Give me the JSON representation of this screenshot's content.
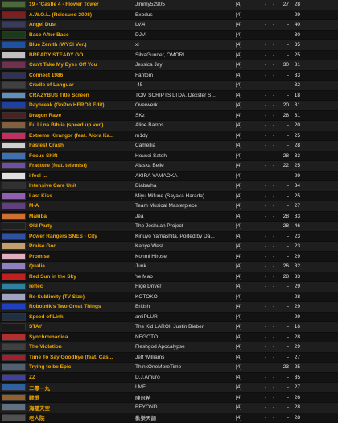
{
  "rows": [
    {
      "title": "19 - 'Castle 4 - Flower Tower",
      "artist": "Jimmy52905",
      "level": "[4]",
      "c1": "-",
      "c2": "-",
      "c3": "27",
      "c4": "28",
      "thumb": "#4a6a3a"
    },
    {
      "title": "A.W.O.L. (Reissued 2008)",
      "artist": "Exodus",
      "level": "[4]",
      "c1": "-",
      "c2": "-",
      "c3": "-",
      "c4": "29",
      "thumb": "#7a2020"
    },
    {
      "title": "Angel Dust",
      "artist": "LV.4",
      "level": "[4]",
      "c1": "-",
      "c2": "-",
      "c3": "-",
      "c4": "40",
      "thumb": "#3a3a5a"
    },
    {
      "title": "Base After Base",
      "artist": "DJVI",
      "level": "[4]",
      "c1": "-",
      "c2": "-",
      "c3": "-",
      "c4": "30",
      "thumb": "#1a3a1a"
    },
    {
      "title": "Blue Zenith (WYSI Ver.)",
      "artist": "xi",
      "level": "[4]",
      "c1": "-",
      "c2": "-",
      "c3": "-",
      "c4": "35",
      "thumb": "#2050a0"
    },
    {
      "title": "BREADY STEADY GO",
      "artist": "SilvaGunner, OMORI",
      "level": "[4]",
      "c1": "-",
      "c2": "-",
      "c3": "-",
      "c4": "25",
      "thumb": "#c0c0c0"
    },
    {
      "title": "Can't Take My Eyes Off You",
      "artist": "Jessica Jay",
      "level": "[4]",
      "c1": "-",
      "c2": "-",
      "c3": "30",
      "c4": "31",
      "thumb": "#703050"
    },
    {
      "title": "Connect 1986",
      "artist": "Fantom",
      "level": "[4]",
      "c1": "-",
      "c2": "-",
      "c3": "-",
      "c4": "33",
      "thumb": "#303060"
    },
    {
      "title": "Cradle of Languar",
      "artist": "-45",
      "level": "[4]",
      "c1": "-",
      "c2": "-",
      "c3": "-",
      "c4": "32",
      "thumb": "#404040"
    },
    {
      "title": "CRAZYBUS Title Screen",
      "artist": "TOM SCRIPTS LTDA, Dexster S...",
      "level": "[4]",
      "c1": "-",
      "c2": "-",
      "c3": "-",
      "c4": "18",
      "thumb": "#6090c0"
    },
    {
      "title": "Daybreak (GoPro HERO3 Edit)",
      "artist": "Overwerk",
      "level": "[4]",
      "c1": "-",
      "c2": "-",
      "c3": "20",
      "c4": "31",
      "thumb": "#2040a0"
    },
    {
      "title": "Dragon Rave",
      "artist": "SKz",
      "level": "[4]",
      "c1": "-",
      "c2": "-",
      "c3": "28",
      "c4": "31",
      "thumb": "#502020"
    },
    {
      "title": "Eu Li na Bíblia (speed up ver.)",
      "artist": "Aline Barros",
      "level": "[4]",
      "c1": "-",
      "c2": "-",
      "c3": "-",
      "c4": "20",
      "thumb": "#806040"
    },
    {
      "title": "Extreme Kirangor (feat. Alora Ka...",
      "artist": "m1dy",
      "level": "[4]",
      "c1": "-",
      "c2": "-",
      "c3": "-",
      "c4": "25",
      "thumb": "#c03060"
    },
    {
      "title": "Fastest Crash",
      "artist": "Camellia",
      "level": "[4]",
      "c1": "-",
      "c2": "-",
      "c3": "-",
      "c4": "28",
      "thumb": "#d0d0d0"
    },
    {
      "title": "Focus Shift",
      "artist": "Housei Satoh",
      "level": "[4]",
      "c1": "-",
      "c2": "-",
      "c3": "28",
      "c4": "33",
      "thumb": "#4070b0"
    },
    {
      "title": "Fracture (feat. telemist)",
      "artist": "Alaska Belle",
      "level": "[4]",
      "c1": "-",
      "c2": "-",
      "c3": "22",
      "c4": "25",
      "thumb": "#7050a0"
    },
    {
      "title": "i feel ...",
      "artist": "AKIRA YAMAOKA",
      "level": "[4]",
      "c1": "-",
      "c2": "-",
      "c3": "-",
      "c4": "29",
      "thumb": "#e0e0e0"
    },
    {
      "title": "Intensive Care Unit",
      "artist": "Diabarha",
      "level": "[4]",
      "c1": "-",
      "c2": "-",
      "c3": "-",
      "c4": "34",
      "thumb": "#303030"
    },
    {
      "title": "Last Kiss",
      "artist": "Miyu Mifune (Sayaka Harada)",
      "level": "[4]",
      "c1": "-",
      "c2": "-",
      "c3": "-",
      "c4": "25",
      "thumb": "#9060b0"
    },
    {
      "title": "M-A",
      "artist": "Team Musical Masterpiece",
      "level": "[4]",
      "c1": "-",
      "c2": "-",
      "c3": "-",
      "c4": "27",
      "thumb": "#604080"
    },
    {
      "title": "Makiba",
      "artist": "Jea",
      "level": "[4]",
      "c1": "-",
      "c2": "-",
      "c3": "28",
      "c4": "33",
      "thumb": "#d07030"
    },
    {
      "title": "Old Party",
      "artist": "The Joshuan Project",
      "level": "[4]",
      "c1": "-",
      "c2": "-",
      "c3": "28",
      "c4": "46",
      "thumb": "#202020"
    },
    {
      "title": "Power Rangers SNES - City",
      "artist": "Kinuyo Yamashita, Ported by Da...",
      "level": "[4]",
      "c1": "-",
      "c2": "-",
      "c3": "-",
      "c4": "23",
      "thumb": "#3050a0"
    },
    {
      "title": "Praise God",
      "artist": "Kanye West",
      "level": "[4]",
      "c1": "-",
      "c2": "-",
      "c3": "-",
      "c4": "23",
      "thumb": "#c0a070"
    },
    {
      "title": "Promise",
      "artist": "Kohmi Hirose",
      "level": "[4]",
      "c1": "-",
      "c2": "-",
      "c3": "-",
      "c4": "29",
      "thumb": "#e0b0c0"
    },
    {
      "title": "Qualia",
      "artist": "Junk",
      "level": "[4]",
      "c1": "-",
      "c2": "-",
      "c3": "26",
      "c4": "32",
      "thumb": "#9080c0"
    },
    {
      "title": "Red Sun in the Sky",
      "artist": "Ye Mao",
      "level": "[4]",
      "c1": "-",
      "c2": "-",
      "c3": "28",
      "c4": "33",
      "thumb": "#c02020"
    },
    {
      "title": "reflec",
      "artist": "Hige Driver",
      "level": "[4]",
      "c1": "-",
      "c2": "-",
      "c3": "-",
      "c4": "29",
      "thumb": "#3080a0"
    },
    {
      "title": "Re-Sublimity (TV Size)",
      "artist": "KOTOKO",
      "level": "[4]",
      "c1": "-",
      "c2": "-",
      "c3": "-",
      "c4": "28",
      "thumb": "#a0a0c0"
    },
    {
      "title": "Robotnik's Two Great Things",
      "artist": "Britishj",
      "level": "[4]",
      "c1": "-",
      "c2": "-",
      "c3": "-",
      "c4": "29",
      "thumb": "#2040c0"
    },
    {
      "title": "Speed of Link",
      "artist": "antiPLUR",
      "level": "[4]",
      "c1": "-",
      "c2": "-",
      "c3": "-",
      "c4": "29",
      "thumb": "#203040"
    },
    {
      "title": "STAY",
      "artist": "The Kid LAROI, Justin Bieber",
      "level": "[4]",
      "c1": "-",
      "c2": "-",
      "c3": "-",
      "c4": "16",
      "thumb": "#1a1a1a"
    },
    {
      "title": "Synchromanica",
      "artist": "NEGOTO",
      "level": "[4]",
      "c1": "-",
      "c2": "-",
      "c3": "-",
      "c4": "28",
      "thumb": "#b03030"
    },
    {
      "title": "The Violation",
      "artist": "Fleshgod Apocalypse",
      "level": "[4]",
      "c1": "-",
      "c2": "-",
      "c3": "-",
      "c4": "29",
      "thumb": "#404040"
    },
    {
      "title": "Time To Say Goodbye (feat. Cas...",
      "artist": "Jeff Williams",
      "level": "[4]",
      "c1": "-",
      "c2": "-",
      "c3": "-",
      "c4": "27",
      "thumb": "#a02030"
    },
    {
      "title": "Trying to be Epic",
      "artist": "ThinkOneMoreTime",
      "level": "[4]",
      "c1": "-",
      "c2": "-",
      "c3": "23",
      "c4": "25",
      "thumb": "#506070"
    },
    {
      "title": "ZZ",
      "artist": "D.J.Amuro",
      "level": "[4]",
      "c1": "-",
      "c2": "-",
      "c3": "-",
      "c4": "35",
      "thumb": "#4040a0"
    },
    {
      "title": "二零一九",
      "artist": "LMF",
      "level": "[4]",
      "c1": "-",
      "c2": "-",
      "c3": "-",
      "c4": "27",
      "thumb": "#3060a0"
    },
    {
      "title": "戰爭",
      "artist": "陳冠希",
      "level": "[4]",
      "c1": "-",
      "c2": "-",
      "c3": "-",
      "c4": "26",
      "thumb": "#906030"
    },
    {
      "title": "海闊天空",
      "artist": "BEYOND",
      "level": "[4]",
      "c1": "-",
      "c2": "-",
      "c3": "-",
      "c4": "28",
      "thumb": "#607080"
    },
    {
      "title": "老人院",
      "artist": "歡樂天韻",
      "level": "[4]",
      "c1": "-",
      "c2": "-",
      "c3": "-",
      "c4": "28",
      "thumb": "#505050"
    }
  ]
}
